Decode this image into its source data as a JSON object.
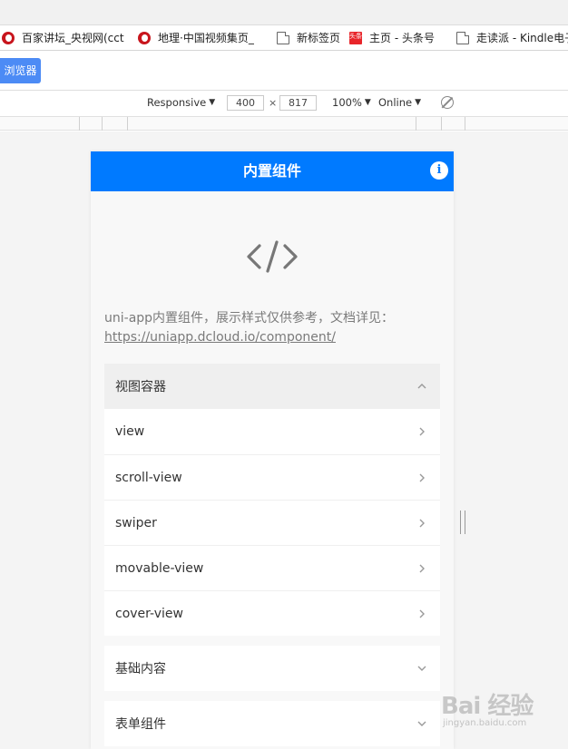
{
  "bookmarks": [
    {
      "label": "百家讲坛_央视网(cct",
      "icon": "cctv-logo-icon"
    },
    {
      "label": "地理·中国视频集页_",
      "icon": "cctv-logo-icon"
    },
    {
      "label": "新标签页",
      "icon": "page-icon"
    },
    {
      "label": "主页 - 头条号",
      "icon": "toutiao-icon"
    },
    {
      "label": "走读派 - Kindle电子",
      "icon": "page-icon"
    }
  ],
  "toutiao_badge": "头条",
  "action": {
    "button_label": "浏览器"
  },
  "device_toolbar": {
    "mode": "Responsive",
    "width": "400",
    "height": "817",
    "zoom": "100%",
    "network": "Online"
  },
  "app": {
    "nav_title": "内置组件",
    "info_glyph": "i",
    "intro_text": "uni-app内置组件，展示样式仅供参考，文档详见：",
    "intro_link": "https://uniapp.dcloud.io/component/",
    "sections": [
      {
        "title": "视图容器",
        "open": true,
        "items": [
          "view",
          "scroll-view",
          "swiper",
          "movable-view",
          "cover-view"
        ]
      },
      {
        "title": "基础内容",
        "open": false
      },
      {
        "title": "表单组件",
        "open": false
      }
    ]
  },
  "watermark": {
    "text": "Bai 经验",
    "sub": "jingyan.baidu.com"
  },
  "colors": {
    "nav_blue": "#007aff",
    "button_blue": "#4c8bf5",
    "page_bg": "#f8f8f8"
  }
}
